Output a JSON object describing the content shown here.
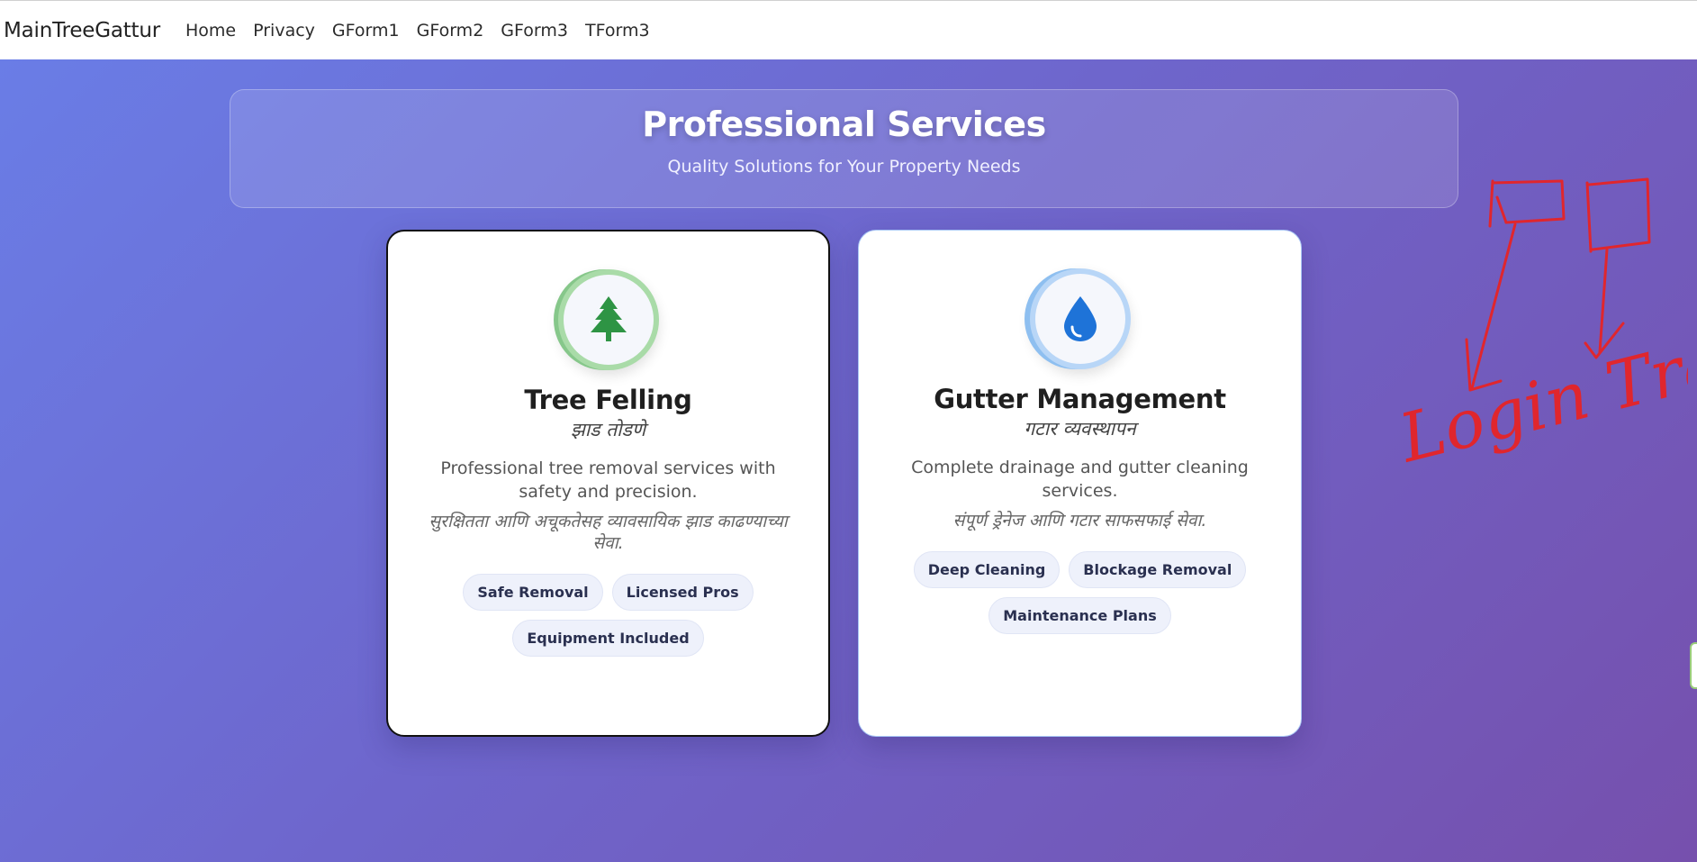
{
  "navbar": {
    "brand": "MainTreeGattur",
    "links": [
      "Home",
      "Privacy",
      "GForm1",
      "GForm2",
      "GForm3",
      "TForm3"
    ]
  },
  "header": {
    "title": "Professional Services",
    "subtitle": "Quality Solutions for Your Property Needs"
  },
  "services": [
    {
      "title": "Tree Felling",
      "title_mr": "झाड तोडणे",
      "description": "Professional tree removal services with safety and precision.",
      "description_mr": "सुरक्षितता आणि अचूकतेसह व्यावसायिक झाड काढण्याच्या सेवा.",
      "tags": [
        "Safe Removal",
        "Licensed Pros",
        "Equipment Included"
      ],
      "icon": "tree-icon",
      "accent": "#2e9444"
    },
    {
      "title": "Gutter Management",
      "title_mr": "गटार व्यवस्थापन",
      "description": "Complete drainage and gutter cleaning services.",
      "description_mr": "संपूर्ण ड्रेनेज आणि गटार साफसफाई सेवा.",
      "tags": [
        "Deep Cleaning",
        "Blockage Removal",
        "Maintenance Plans"
      ],
      "icon": "water-drop-icon",
      "accent": "#1e73d8"
    }
  ],
  "annotation": {
    "text": "Login Track"
  },
  "colors": {
    "gradient_start": "#6a7de6",
    "gradient_end": "#7650ad",
    "annotation": "#e0262d"
  }
}
